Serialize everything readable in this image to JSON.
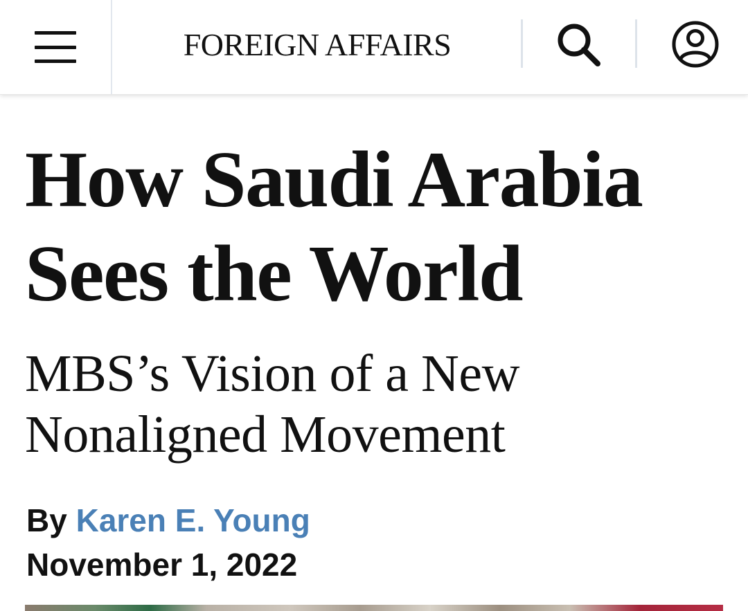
{
  "header": {
    "menu_icon": "hamburger-menu-icon",
    "brand": "FOREIGN AFFAIRS",
    "search_icon": "search-icon",
    "account_icon": "user-account-icon"
  },
  "article": {
    "headline_line1": "How Saudi Arabia",
    "headline_line2": "Sees the World",
    "subhead_line1": "MBS’s Vision of a New",
    "subhead_line2": "Nonaligned Movement",
    "byline_prefix": "By",
    "author": "Karen E. Young",
    "date": "November 1, 2022"
  },
  "colors": {
    "text": "#111111",
    "author_link": "#4a80b6",
    "divider": "#dde3ea"
  }
}
